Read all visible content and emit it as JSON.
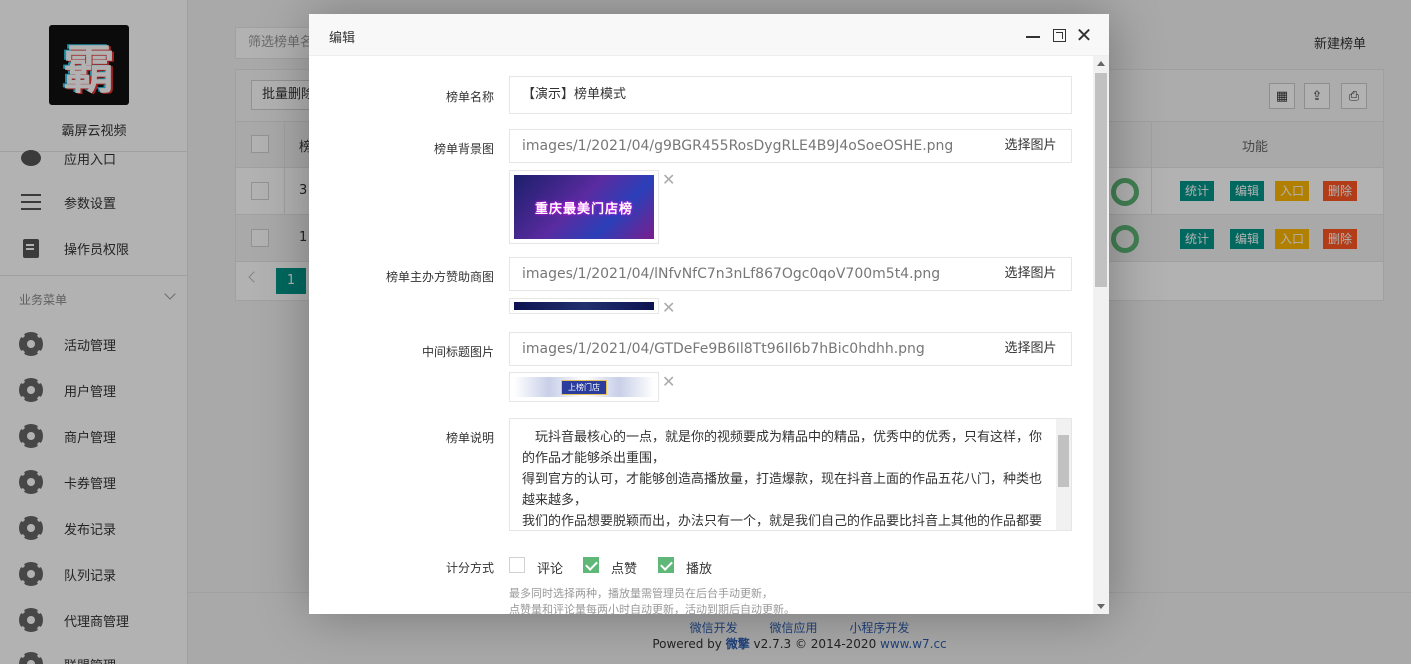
{
  "sidebar": {
    "logo_char": "霸",
    "brand": "霸屏云视频",
    "items_top": [
      {
        "label": "应用入口",
        "icon": "chat-icon"
      },
      {
        "label": "参数设置",
        "icon": "list-icon"
      },
      {
        "label": "操作员权限",
        "icon": "edit-doc-icon"
      }
    ],
    "section_title": "业务菜单",
    "items": [
      {
        "label": "活动管理",
        "icon": "gear-icon"
      },
      {
        "label": "用户管理",
        "icon": "gear-icon"
      },
      {
        "label": "商户管理",
        "icon": "gear-icon"
      },
      {
        "label": "卡券管理",
        "icon": "gear-icon"
      },
      {
        "label": "发布记录",
        "icon": "gear-icon"
      },
      {
        "label": "队列记录",
        "icon": "gear-icon"
      },
      {
        "label": "代理商管理",
        "icon": "gear-icon"
      },
      {
        "label": "联盟管理",
        "icon": "gear-icon"
      }
    ]
  },
  "main": {
    "filter_placeholder": "筛选榜单名",
    "new_list_label": "新建榜单",
    "batch_delete_label": "批量删除",
    "header_col2": "榜",
    "header_func": "功能",
    "rows": [
      {
        "num": "3",
        "actions": [
          "统计",
          "编辑",
          "入口",
          "删除"
        ]
      },
      {
        "num": "1",
        "actions": [
          "统计",
          "编辑",
          "入口",
          "删除"
        ]
      }
    ],
    "page": "1"
  },
  "footer": {
    "links": [
      "微信开发",
      "微信应用",
      "小程序开发"
    ],
    "powered_prefix": "Powered by ",
    "powered_brand": "微擎",
    "powered_version": " v2.7.3 © 2014-2020 ",
    "powered_site": "www.w7.cc"
  },
  "modal": {
    "title": "编辑",
    "fields": {
      "name_label": "榜单名称",
      "name_value": "【演示】榜单模式",
      "bg_label": "榜单背景图",
      "bg_path": "images/1/2021/04/g9BGR455RosDygRLE4B9J4oSoeOSHE.png",
      "bg_banner_text": "重庆最美门店榜",
      "sponsor_label": "榜单主办方赞助商图",
      "sponsor_path": "images/1/2021/04/lNfvNfC7n3nLf867Ogc0qoV700m5t4.png",
      "mid_label": "中间标题图片",
      "mid_path": "images/1/2021/04/GTDeFe9B6Il8Tt96Il6b7hBic0hdhh.png",
      "mid_banner_text": "上榜门店",
      "pick_label": "选择图片",
      "desc_label": "榜单说明",
      "desc_lines": [
        "　玩抖音最核心的一点，就是你的视频要成为精品中的精品，优秀中的优秀，只有这样，你的作品才能够杀出重围，",
        "得到官方的认可，才能够创造高播放量，打造爆款，现在抖音上面的作品五花八门，种类也越来越多，",
        "我们的作品想要脱颖而出，办法只有一个，就是我们自己的作品要比抖音上其他的作品都要好，都要优秀。"
      ],
      "score_label": "计分方式",
      "score_options": [
        {
          "label": "评论",
          "checked": false
        },
        {
          "label": "点赞",
          "checked": true
        },
        {
          "label": "播放",
          "checked": true
        }
      ],
      "hint_lines": [
        "最多同时选择两种，播放量需管理员在后台手动更新，",
        "点赞量和评论量每两小时自动更新，活动到期后自动更新。"
      ]
    }
  },
  "colors": {
    "primary_green": "#009688",
    "warm_orange": "#ffb800",
    "danger_red": "#ff5722",
    "check_green": "#5fb878"
  }
}
